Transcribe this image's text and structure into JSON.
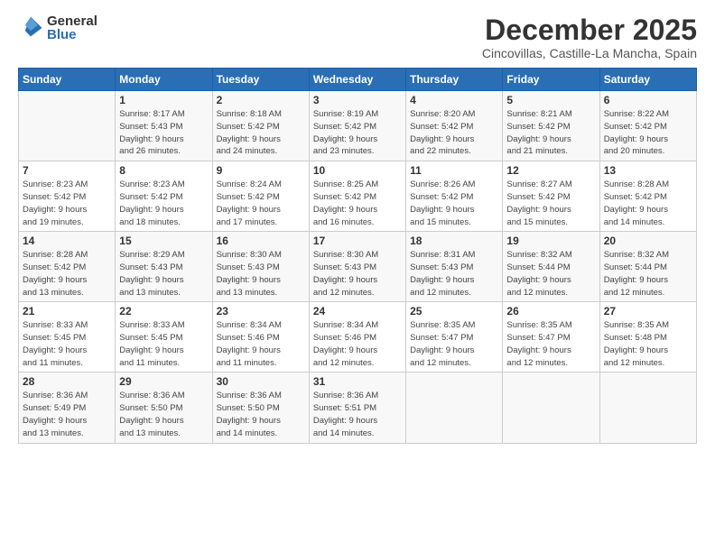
{
  "logo": {
    "general": "General",
    "blue": "Blue"
  },
  "title": "December 2025",
  "subtitle": "Cincovillas, Castille-La Mancha, Spain",
  "weekdays": [
    "Sunday",
    "Monday",
    "Tuesday",
    "Wednesday",
    "Thursday",
    "Friday",
    "Saturday"
  ],
  "weeks": [
    [
      {
        "day": "",
        "info": ""
      },
      {
        "day": "1",
        "info": "Sunrise: 8:17 AM\nSunset: 5:43 PM\nDaylight: 9 hours\nand 26 minutes."
      },
      {
        "day": "2",
        "info": "Sunrise: 8:18 AM\nSunset: 5:42 PM\nDaylight: 9 hours\nand 24 minutes."
      },
      {
        "day": "3",
        "info": "Sunrise: 8:19 AM\nSunset: 5:42 PM\nDaylight: 9 hours\nand 23 minutes."
      },
      {
        "day": "4",
        "info": "Sunrise: 8:20 AM\nSunset: 5:42 PM\nDaylight: 9 hours\nand 22 minutes."
      },
      {
        "day": "5",
        "info": "Sunrise: 8:21 AM\nSunset: 5:42 PM\nDaylight: 9 hours\nand 21 minutes."
      },
      {
        "day": "6",
        "info": "Sunrise: 8:22 AM\nSunset: 5:42 PM\nDaylight: 9 hours\nand 20 minutes."
      }
    ],
    [
      {
        "day": "7",
        "info": "Sunrise: 8:23 AM\nSunset: 5:42 PM\nDaylight: 9 hours\nand 19 minutes."
      },
      {
        "day": "8",
        "info": "Sunrise: 8:23 AM\nSunset: 5:42 PM\nDaylight: 9 hours\nand 18 minutes."
      },
      {
        "day": "9",
        "info": "Sunrise: 8:24 AM\nSunset: 5:42 PM\nDaylight: 9 hours\nand 17 minutes."
      },
      {
        "day": "10",
        "info": "Sunrise: 8:25 AM\nSunset: 5:42 PM\nDaylight: 9 hours\nand 16 minutes."
      },
      {
        "day": "11",
        "info": "Sunrise: 8:26 AM\nSunset: 5:42 PM\nDaylight: 9 hours\nand 15 minutes."
      },
      {
        "day": "12",
        "info": "Sunrise: 8:27 AM\nSunset: 5:42 PM\nDaylight: 9 hours\nand 15 minutes."
      },
      {
        "day": "13",
        "info": "Sunrise: 8:28 AM\nSunset: 5:42 PM\nDaylight: 9 hours\nand 14 minutes."
      }
    ],
    [
      {
        "day": "14",
        "info": "Sunrise: 8:28 AM\nSunset: 5:42 PM\nDaylight: 9 hours\nand 13 minutes."
      },
      {
        "day": "15",
        "info": "Sunrise: 8:29 AM\nSunset: 5:43 PM\nDaylight: 9 hours\nand 13 minutes."
      },
      {
        "day": "16",
        "info": "Sunrise: 8:30 AM\nSunset: 5:43 PM\nDaylight: 9 hours\nand 13 minutes."
      },
      {
        "day": "17",
        "info": "Sunrise: 8:30 AM\nSunset: 5:43 PM\nDaylight: 9 hours\nand 12 minutes."
      },
      {
        "day": "18",
        "info": "Sunrise: 8:31 AM\nSunset: 5:43 PM\nDaylight: 9 hours\nand 12 minutes."
      },
      {
        "day": "19",
        "info": "Sunrise: 8:32 AM\nSunset: 5:44 PM\nDaylight: 9 hours\nand 12 minutes."
      },
      {
        "day": "20",
        "info": "Sunrise: 8:32 AM\nSunset: 5:44 PM\nDaylight: 9 hours\nand 12 minutes."
      }
    ],
    [
      {
        "day": "21",
        "info": "Sunrise: 8:33 AM\nSunset: 5:45 PM\nDaylight: 9 hours\nand 11 minutes."
      },
      {
        "day": "22",
        "info": "Sunrise: 8:33 AM\nSunset: 5:45 PM\nDaylight: 9 hours\nand 11 minutes."
      },
      {
        "day": "23",
        "info": "Sunrise: 8:34 AM\nSunset: 5:46 PM\nDaylight: 9 hours\nand 11 minutes."
      },
      {
        "day": "24",
        "info": "Sunrise: 8:34 AM\nSunset: 5:46 PM\nDaylight: 9 hours\nand 12 minutes."
      },
      {
        "day": "25",
        "info": "Sunrise: 8:35 AM\nSunset: 5:47 PM\nDaylight: 9 hours\nand 12 minutes."
      },
      {
        "day": "26",
        "info": "Sunrise: 8:35 AM\nSunset: 5:47 PM\nDaylight: 9 hours\nand 12 minutes."
      },
      {
        "day": "27",
        "info": "Sunrise: 8:35 AM\nSunset: 5:48 PM\nDaylight: 9 hours\nand 12 minutes."
      }
    ],
    [
      {
        "day": "28",
        "info": "Sunrise: 8:36 AM\nSunset: 5:49 PM\nDaylight: 9 hours\nand 13 minutes."
      },
      {
        "day": "29",
        "info": "Sunrise: 8:36 AM\nSunset: 5:50 PM\nDaylight: 9 hours\nand 13 minutes."
      },
      {
        "day": "30",
        "info": "Sunrise: 8:36 AM\nSunset: 5:50 PM\nDaylight: 9 hours\nand 14 minutes."
      },
      {
        "day": "31",
        "info": "Sunrise: 8:36 AM\nSunset: 5:51 PM\nDaylight: 9 hours\nand 14 minutes."
      },
      {
        "day": "",
        "info": ""
      },
      {
        "day": "",
        "info": ""
      },
      {
        "day": "",
        "info": ""
      }
    ]
  ]
}
